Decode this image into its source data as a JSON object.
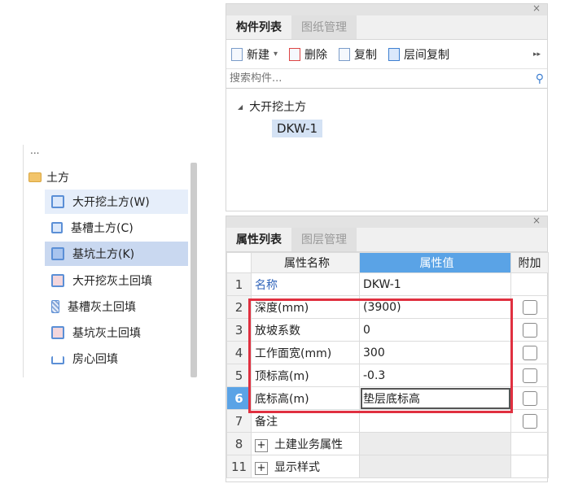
{
  "left_tree": {
    "cut_item": "...",
    "folder": "土方",
    "items": [
      {
        "label": "大开挖土方(W)",
        "icon": "excavation-icon"
      },
      {
        "label": "基槽土方(C)",
        "icon": "trench-icon"
      },
      {
        "label": "基坑土方(K)",
        "icon": "pit-icon"
      },
      {
        "label": "大开挖灰土回填",
        "icon": "excavation-backfill-icon"
      },
      {
        "label": "基槽灰土回填",
        "icon": "trench-backfill-icon"
      },
      {
        "label": "基坑灰土回填",
        "icon": "pit-backfill-icon"
      },
      {
        "label": "房心回填",
        "icon": "room-backfill-icon"
      }
    ]
  },
  "component_panel": {
    "close": "×",
    "tabs": [
      "构件列表",
      "图纸管理"
    ],
    "toolbar": {
      "new": "新建",
      "dropdown": "▾",
      "delete": "删除",
      "copy": "复制",
      "floor_copy": "层间复制",
      "more": "▸▸"
    },
    "search_placeholder": "搜索构件...",
    "tree": {
      "expander": "◢",
      "parent": "大开挖土方",
      "child": "DKW-1"
    }
  },
  "property_panel": {
    "close": "×",
    "tabs": [
      "属性列表",
      "图层管理"
    ],
    "headers": {
      "name": "属性名称",
      "value": "属性值",
      "extra": "附加"
    },
    "rows": [
      {
        "num": "1",
        "name": "名称",
        "value": "DKW-1"
      },
      {
        "num": "2",
        "name": "深度(mm)",
        "value": "(3900)"
      },
      {
        "num": "3",
        "name": "放坡系数",
        "value": "0"
      },
      {
        "num": "4",
        "name": "工作面宽(mm)",
        "value": "300"
      },
      {
        "num": "5",
        "name": "顶标高(m)",
        "value": "-0.3"
      },
      {
        "num": "6",
        "name": "底标高(m)",
        "value": "垫层底标高"
      },
      {
        "num": "7",
        "name": "备注",
        "value": ""
      },
      {
        "num": "8",
        "name": "土建业务属性",
        "value": ""
      },
      {
        "num": "11",
        "name": "显示样式",
        "value": ""
      }
    ],
    "plus": "+"
  },
  "colors": {
    "accent": "#5aa3e6",
    "highlight_box": "#e03040",
    "selection": "#c9d8f0"
  }
}
